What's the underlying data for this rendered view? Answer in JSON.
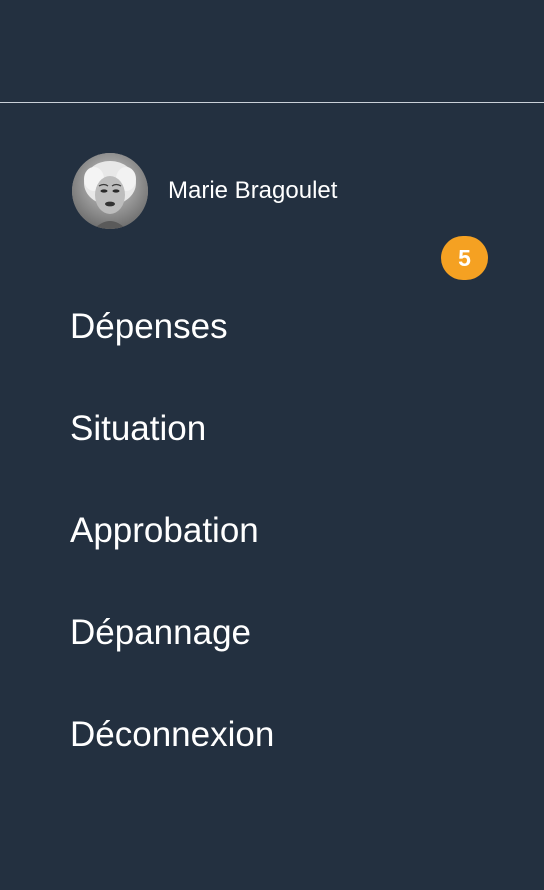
{
  "user": {
    "name": "Marie Bragoulet"
  },
  "menu": {
    "items": [
      {
        "label": "Dépenses"
      },
      {
        "label": "Situation"
      },
      {
        "label": "Approbation",
        "badge": "5"
      },
      {
        "label": "Dépannage"
      },
      {
        "label": "Déconnexion"
      }
    ]
  },
  "colors": {
    "background": "#233040",
    "badge": "#f5a122",
    "divider": "#c9d0d8",
    "text": "#ffffff"
  }
}
